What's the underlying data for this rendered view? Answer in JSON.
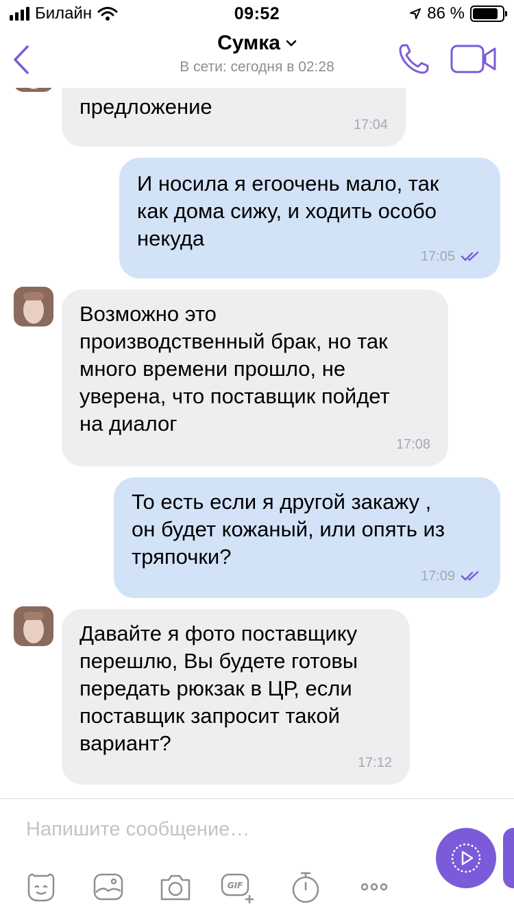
{
  "status_bar": {
    "carrier": "Билайн",
    "time": "09:52",
    "battery": "86 %",
    "battery_level": 0.86
  },
  "header": {
    "title": "Сумка",
    "subtitle": "В сети: сегодня в 02:28",
    "accent_color": "#7b5bd9"
  },
  "messages": [
    {
      "direction": "incoming",
      "text": "предложение",
      "time": "17:04"
    },
    {
      "direction": "outgoing",
      "text": "И носила я егоочень мало, так\nкак дома сижу, и ходить особо\nнекуда",
      "time": "17:05"
    },
    {
      "direction": "incoming",
      "text": "Возможно это\nпроизводственный брак, но так\nмного времени прошло, не\nуверена, что поставщик пойдет\nна диалог",
      "time": "17:08"
    },
    {
      "direction": "outgoing",
      "text": "То есть если я другой закажу ,\nон будет кожаный, или опять из\nтряпочки?",
      "time": "17:09"
    },
    {
      "direction": "incoming",
      "text": "Давайте я фото поставщику\nперешлю, Вы будете готовы\nпередать рюкзак в ЦР, если\nпоставщик запросит такой\nвариант?",
      "time": "17:12"
    }
  ],
  "composer": {
    "placeholder": "Напишите сообщение…",
    "tools": [
      "sticker-icon",
      "gallery-icon",
      "camera-icon",
      "gif-icon",
      "timer-icon",
      "more-icon"
    ]
  },
  "colors": {
    "incoming_bubble": "#eeeef0",
    "outgoing_bubble": "#d2e2f7",
    "accent": "#7b5bd9"
  }
}
